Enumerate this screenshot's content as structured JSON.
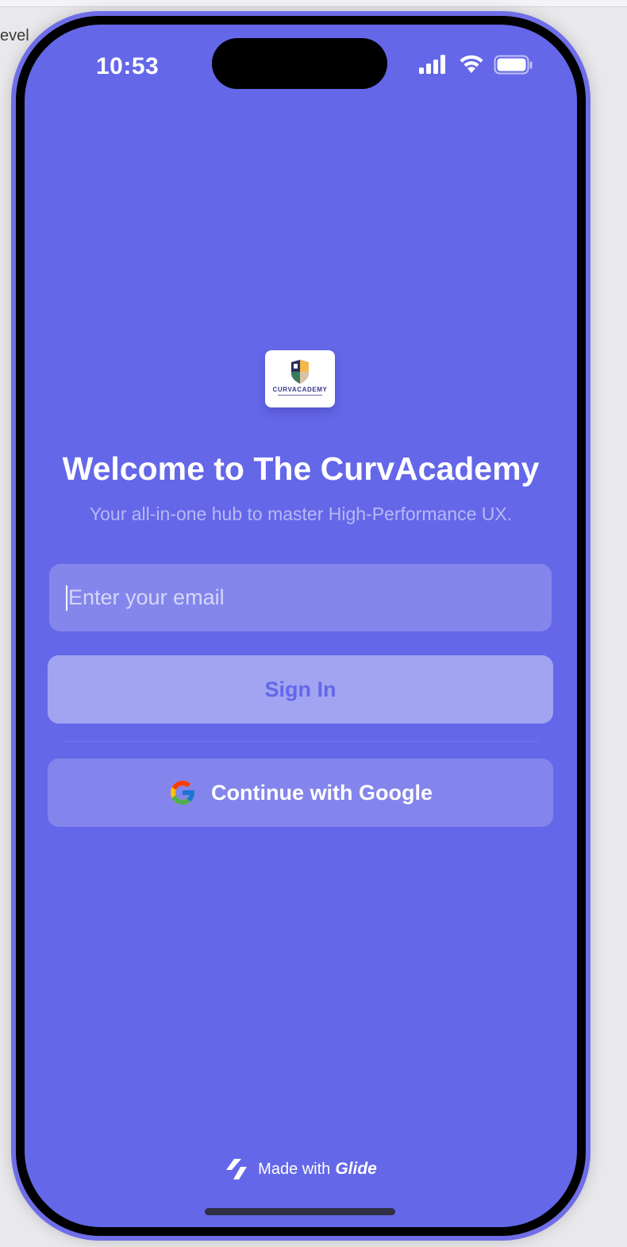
{
  "background": {
    "partial_text": "evel"
  },
  "status_bar": {
    "time": "10:53"
  },
  "logo": {
    "wordmark": "CURVACADEMY"
  },
  "welcome": {
    "title": "Welcome to The CurvAcademy",
    "subtitle": "Your all-in-one hub to master High-Performance UX."
  },
  "form": {
    "email_value": "",
    "email_placeholder": "Enter your email",
    "sign_in_label": "Sign In",
    "google_label": "Continue with Google"
  },
  "footer": {
    "made_with": "Made with",
    "brand": "Glide"
  },
  "colors": {
    "screen_bg": "#6467e8",
    "input_bg": "#8486ec",
    "signin_bg": "#a2a4f2",
    "google_bg": "#8385ec"
  },
  "icons": [
    "signal-icon",
    "wifi-icon",
    "battery-icon",
    "google-icon",
    "glide-icon"
  ]
}
